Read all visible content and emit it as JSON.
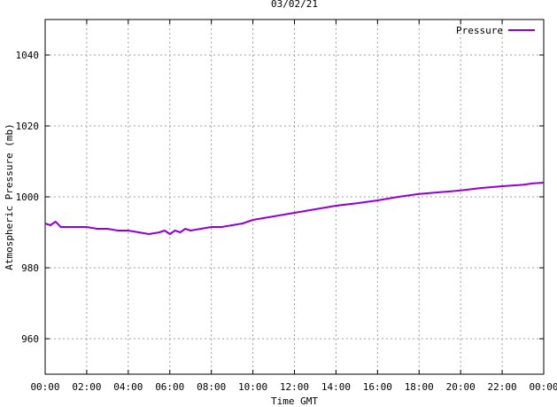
{
  "chart_data": {
    "type": "line",
    "title": "03/02/21",
    "xlabel": "Time GMT",
    "ylabel": "Atmospheric Pressure (mb)",
    "xlim": [
      0,
      24
    ],
    "ylim": [
      950,
      1050
    ],
    "x_ticks": [
      "00:00",
      "02:00",
      "04:00",
      "06:00",
      "08:00",
      "10:00",
      "12:00",
      "14:00",
      "16:00",
      "18:00",
      "20:00",
      "22:00",
      "00:00"
    ],
    "y_ticks": [
      960,
      980,
      1000,
      1020,
      1040
    ],
    "grid": true,
    "legend_position": "top-right",
    "series": [
      {
        "name": "Pressure",
        "color": "#9400d3",
        "x": [
          0,
          0.25,
          0.5,
          0.75,
          1,
          1.5,
          2,
          2.5,
          3,
          3.5,
          4,
          4.5,
          5,
          5.5,
          5.75,
          6,
          6.25,
          6.5,
          6.75,
          7,
          7.5,
          8,
          8.5,
          9,
          9.5,
          10,
          11,
          12,
          13,
          14,
          15,
          16,
          17,
          18,
          19,
          20,
          21,
          22,
          23,
          23.5,
          24
        ],
        "y": [
          992.5,
          992,
          993,
          991.5,
          991.5,
          991.5,
          991.5,
          991,
          991,
          990.5,
          990.5,
          990,
          989.5,
          990,
          990.5,
          989.5,
          990.5,
          990,
          991,
          990.5,
          991,
          991.5,
          991.5,
          992,
          992.5,
          993.5,
          994.5,
          995.5,
          996.5,
          997.5,
          998.2,
          999,
          1000,
          1000.8,
          1001.3,
          1001.8,
          1002.5,
          1003,
          1003.4,
          1003.8,
          1004
        ]
      }
    ]
  }
}
